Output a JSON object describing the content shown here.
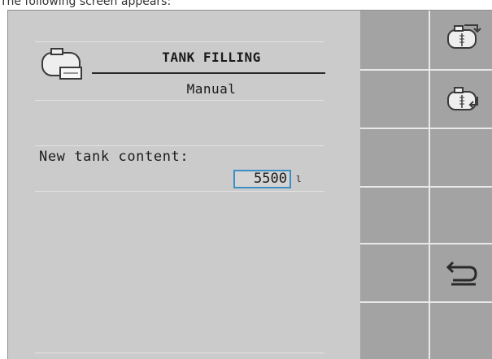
{
  "caption": "The following screen appears:",
  "screen": {
    "title": "TANK FILLING",
    "subtitle": "Manual",
    "field_label": "New tank content:",
    "field_value": "5500",
    "field_unit": "l"
  },
  "softkeys": [
    {
      "name": "tank-fill-icon"
    },
    {
      "name": "tank-refill-icon"
    },
    {
      "name": "empty"
    },
    {
      "name": "empty"
    },
    {
      "name": "back-icon"
    },
    {
      "name": "empty"
    }
  ],
  "colors": {
    "screen_bg": "#cbcbcb",
    "softkey_bg": "#a3a3a3",
    "field_border": "#3a8fc4",
    "divider": "#e9e9e9"
  }
}
